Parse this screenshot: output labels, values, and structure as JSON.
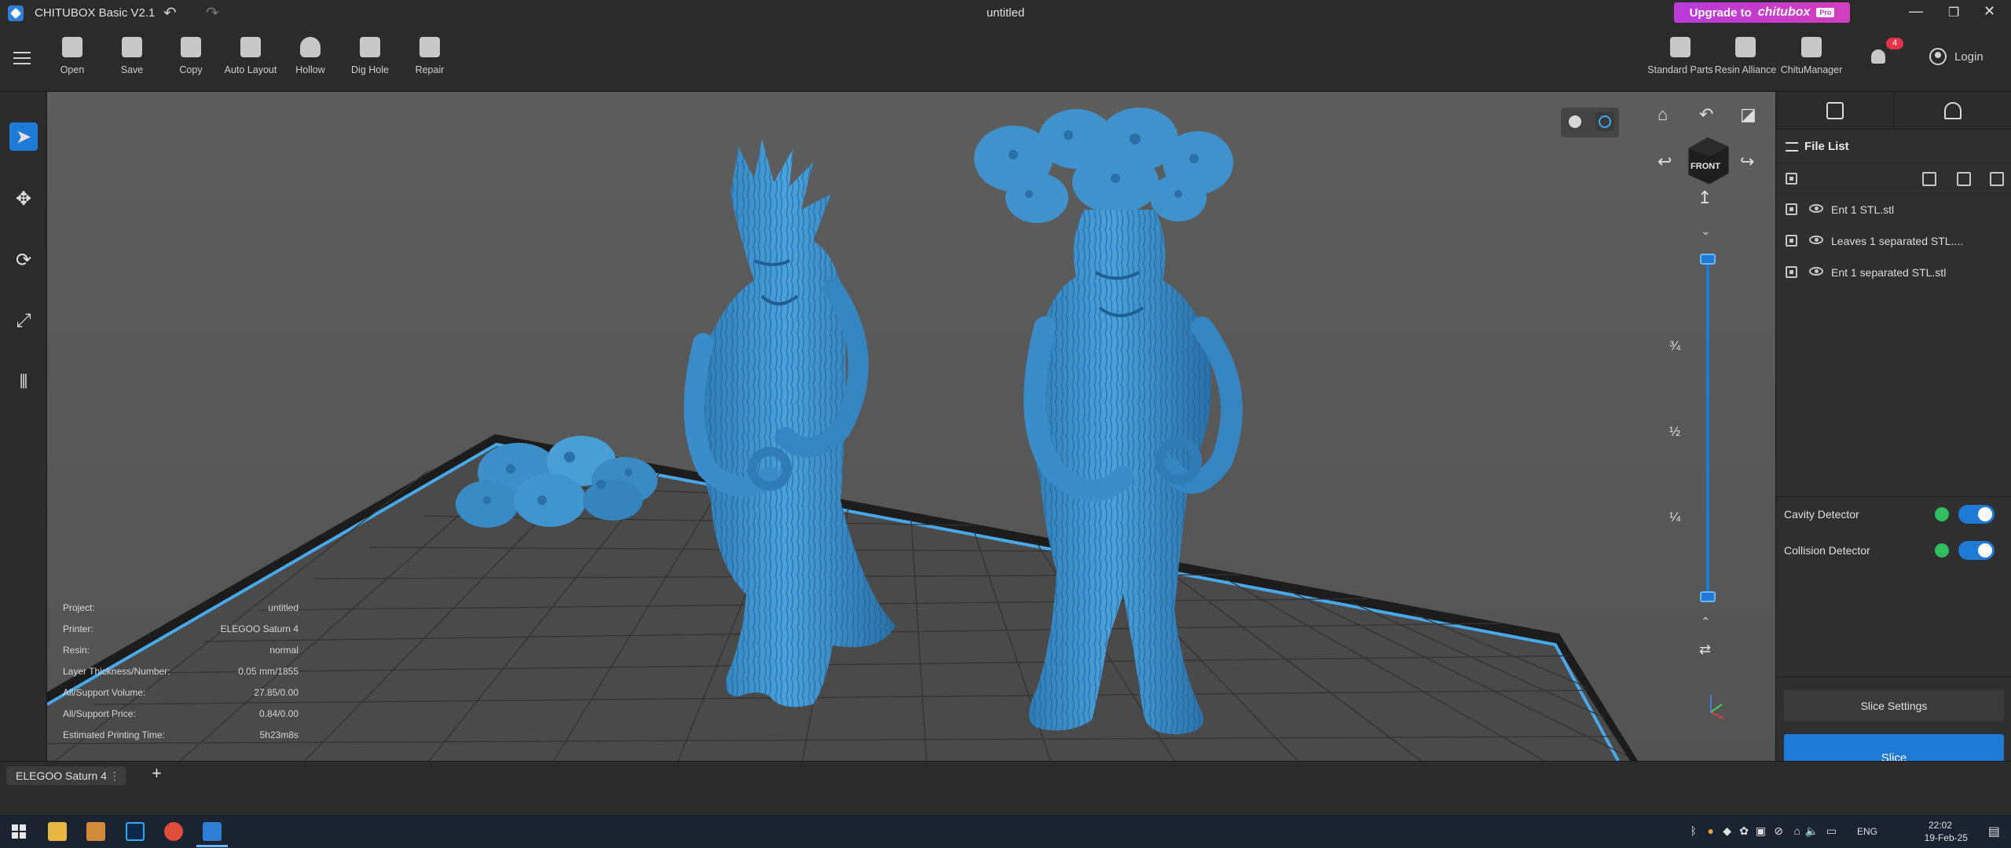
{
  "app": {
    "title": "CHITUBOX Basic V2.1",
    "document_title": "untitled"
  },
  "upgrade": {
    "label": "Upgrade to",
    "brand": "chitubox",
    "badge": "Pro"
  },
  "toolbar": {
    "tools": [
      "Open",
      "Save",
      "Copy",
      "Auto Layout",
      "Hollow",
      "Dig Hole",
      "Repair"
    ],
    "right_tools": [
      "Standard Parts",
      "Resin Alliance",
      "ChituManager"
    ],
    "notification_count": "4",
    "login_label": "Login"
  },
  "viewport": {
    "view_cube_label": "FRONT",
    "slider_marks": [
      "¾",
      "½",
      "¼"
    ],
    "info": [
      {
        "label": "Project:",
        "value": "untitled"
      },
      {
        "label": "Printer:",
        "value": "ELEGOO Saturn 4"
      },
      {
        "label": "Resin:",
        "value": "normal"
      },
      {
        "label": "Layer Thickness/Number:",
        "value": "0.05 mm/1855"
      },
      {
        "label": "All/Support Volume:",
        "value": "27.85/0.00"
      },
      {
        "label": "All/Support Price:",
        "value": "0.84/0.00"
      },
      {
        "label": "Estimated Printing Time:",
        "value": "5h23m8s"
      }
    ]
  },
  "file_list": {
    "title": "File List",
    "files": [
      "Ent 1 STL.stl",
      "Leaves 1 separated STL....",
      "Ent 1 separated STL.stl"
    ]
  },
  "detectors": [
    {
      "label": "Cavity Detector",
      "enabled": true
    },
    {
      "label": "Collision Detector",
      "enabled": true
    }
  ],
  "actions": {
    "slice_settings": "Slice Settings",
    "slice": "Slice"
  },
  "bottom": {
    "printer_tab": "ELEGOO Saturn 4",
    "add_tab": "+"
  },
  "taskbar": {
    "language": "ENG",
    "time": "22:02",
    "date": "19-Feb-25"
  },
  "colors": {
    "accent": "#1f7ad6",
    "model": "#3f92c8",
    "platform_edge": "#48a8ea",
    "upgrade": "#c23dd0"
  }
}
